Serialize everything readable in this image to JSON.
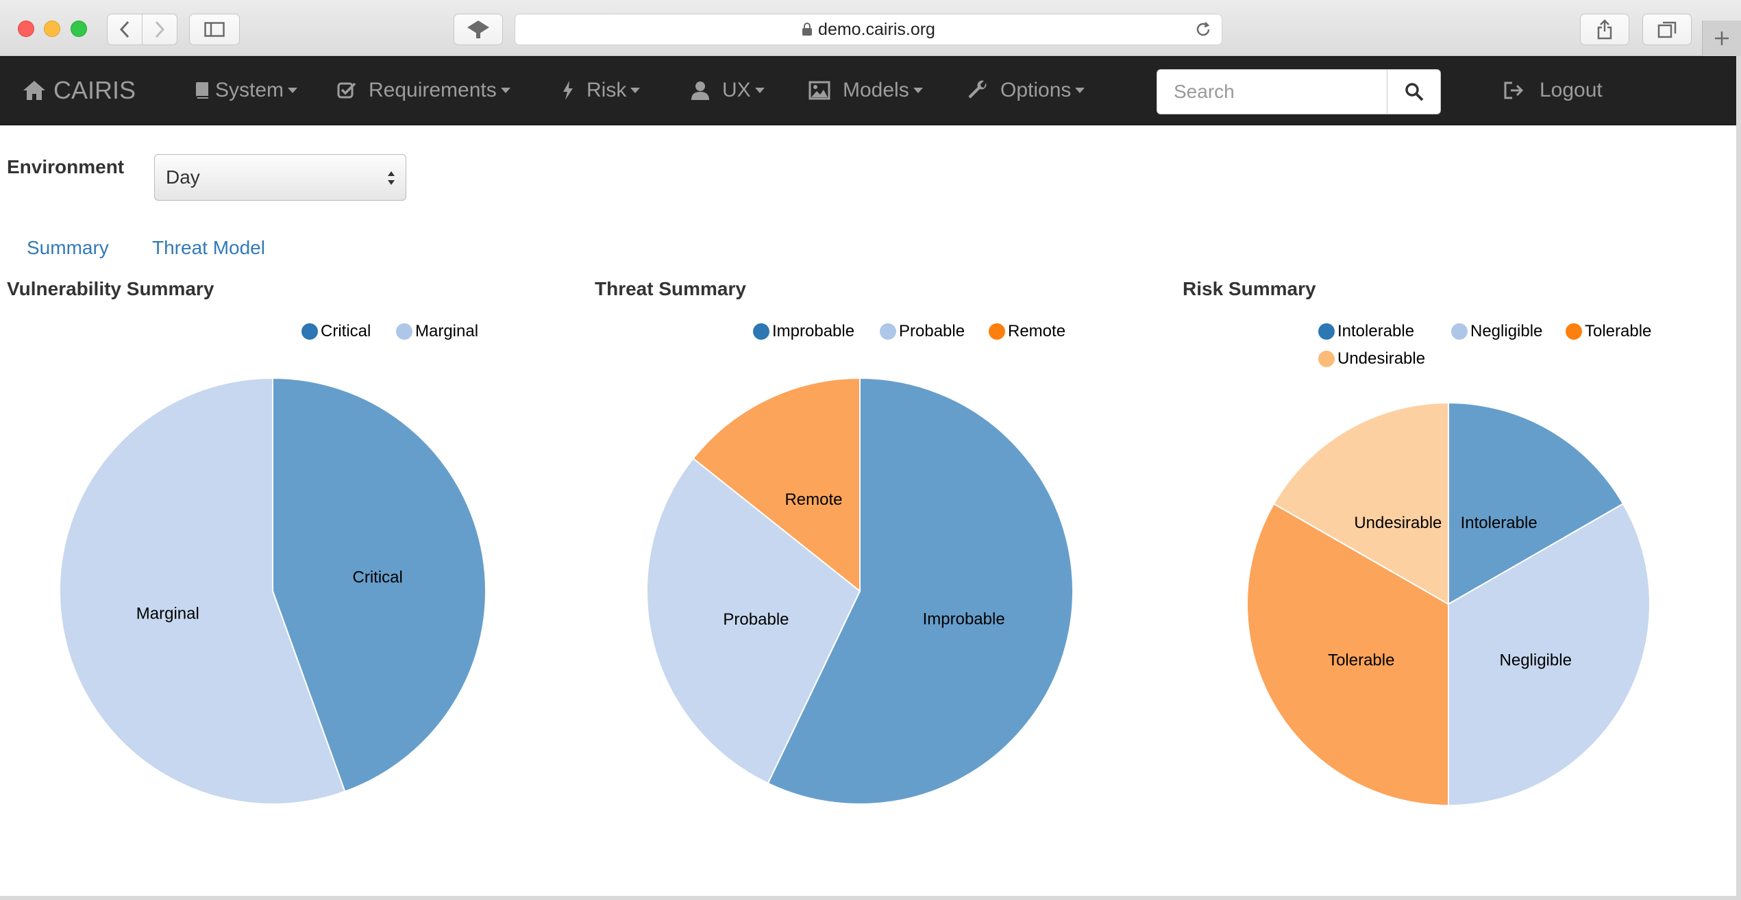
{
  "browser": {
    "url": "demo.cairis.org"
  },
  "navbar": {
    "brand": "CAIRIS",
    "items": [
      {
        "label": "System"
      },
      {
        "label": "Requirements"
      },
      {
        "label": "Risk"
      },
      {
        "label": "UX"
      },
      {
        "label": "Models"
      },
      {
        "label": "Options"
      }
    ],
    "search_placeholder": "Search",
    "logout_label": "Logout"
  },
  "environment": {
    "label": "Environment",
    "selected": "Day"
  },
  "tabs": [
    {
      "label": "Summary"
    },
    {
      "label": "Threat Model"
    }
  ],
  "chart_data": [
    {
      "type": "pie",
      "title": "Vulnerability Summary",
      "categories": [
        "Critical",
        "Marginal"
      ],
      "values": [
        44.5,
        55.5
      ],
      "colors": [
        "#669ecb",
        "#c6d7ef"
      ],
      "legend": [
        {
          "label": "Critical",
          "color": "#2c77b4"
        },
        {
          "label": "Marginal",
          "color": "#aec7e8"
        }
      ]
    },
    {
      "type": "pie",
      "title": "Threat Summary",
      "categories": [
        "Improbable",
        "Probable",
        "Remote"
      ],
      "values": [
        57.1,
        28.6,
        14.3
      ],
      "colors": [
        "#669ecb",
        "#c6d7ef",
        "#fca45a"
      ],
      "legend": [
        {
          "label": "Improbable",
          "color": "#2c77b4"
        },
        {
          "label": "Probable",
          "color": "#aec7e8"
        },
        {
          "label": "Remote",
          "color": "#fd7f0e"
        }
      ]
    },
    {
      "type": "pie",
      "title": "Risk Summary",
      "categories": [
        "Intolerable",
        "Negligible",
        "Tolerable",
        "Undesirable"
      ],
      "values": [
        16.7,
        33.3,
        33.3,
        16.7
      ],
      "colors": [
        "#669ecb",
        "#c6d7ef",
        "#fca45a",
        "#fdd0a2"
      ],
      "legend": [
        {
          "label": "Intolerable",
          "color": "#2c77b4"
        },
        {
          "label": "Negligible",
          "color": "#aec7e8"
        },
        {
          "label": "Tolerable",
          "color": "#fd7f0e"
        },
        {
          "label": "Undesirable",
          "color": "#fdbb78"
        }
      ]
    }
  ]
}
